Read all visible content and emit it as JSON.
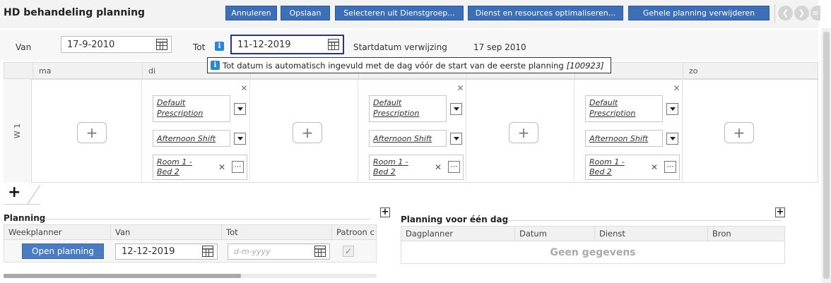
{
  "header": {
    "title": "HD behandeling planning",
    "buttons": [
      "Annuleren",
      "Opslaan",
      "Selecteren uit Dienstgroep...",
      "Dienst en resources optimaliseren...",
      "Gehele planning verwijderen"
    ],
    "nav_icons": [
      "chevron-left-icon",
      "chevron-right-icon",
      "menu-icon"
    ]
  },
  "filter": {
    "van_label": "Van",
    "van_value": "17-9-2010",
    "tot_label": "Tot",
    "tot_value": "11-12-2019",
    "start_label": "Startdatum verwijzing",
    "start_value": "17 sep 2010"
  },
  "tooltip": {
    "text": "Tot datum is automatisch ingevuld met de dag vóór de start van de eerste planning",
    "code": "[100923]"
  },
  "grid": {
    "days": [
      "ma",
      "di",
      "",
      "",
      "",
      "",
      "zo"
    ],
    "week_label": "W 1",
    "entry": {
      "prescription_line1": "Default",
      "prescription_line2": "Prescription",
      "shift": "Afternoon Shift",
      "room_line1": "Room 1 -",
      "room_line2": "Bed 2"
    },
    "add_symbol": "+"
  },
  "planning": {
    "title": "Planning",
    "columns": [
      "Weekplanner",
      "Van",
      "Tot",
      "Patroon c"
    ],
    "row": {
      "button": "Open planning",
      "van": "12-12-2019",
      "tot_placeholder": "d-m-yyyy",
      "patroon_checked": true
    }
  },
  "day_planning": {
    "title": "Planning voor één dag",
    "columns": [
      "Dagplanner",
      "Datum",
      "Dienst",
      "Bron"
    ],
    "empty_text": "Geen gegevens"
  },
  "colors": {
    "accent": "#3c6fb8",
    "info": "#2b86d6"
  }
}
